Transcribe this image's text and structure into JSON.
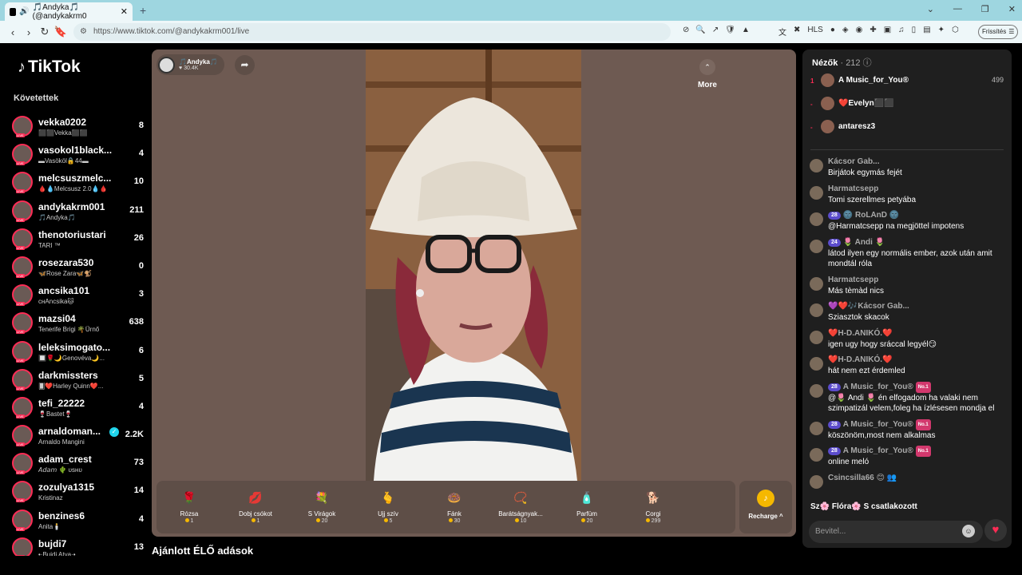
{
  "browser": {
    "tab_title": "🎵Andyka🎵 (@andykakrm0",
    "url": "https://www.tiktok.com/@andykakrm001/live",
    "update_label": "Frissítés"
  },
  "tiktok": {
    "logo": "TikTok",
    "following_title": "Követettek",
    "accounts": [
      {
        "name": "vekka0202",
        "sub": "⬛⬛Vekka⬛⬛",
        "count": "8"
      },
      {
        "name": "vasokol1black...",
        "sub": "▬Vasököl🔒44▬",
        "count": "4"
      },
      {
        "name": "melcsuszmelc...",
        "sub": "🩸💧Melcsusz 2.0💧🩸",
        "count": "10"
      },
      {
        "name": "andykakrm001",
        "sub": "🎵Andyka🎵",
        "count": "211"
      },
      {
        "name": "thenotoriustari",
        "sub": "TARI ™",
        "count": "26"
      },
      {
        "name": "rosezara530",
        "sub": "🦋Rose Zara🦋🐒",
        "count": "0"
      },
      {
        "name": "ancsika101",
        "sub": "ᴄʜAncsika🐱",
        "count": "3"
      },
      {
        "name": "mazsi04",
        "sub": "Tenerife Brigi 🌴Ürnő",
        "count": "638"
      },
      {
        "name": "leleksimogato...",
        "sub": "🔲🌹🌙Genovéva🌙...",
        "count": "6"
      },
      {
        "name": "darkmissters",
        "sub": "🂠❤️Harley Quinn❤️...",
        "count": "5"
      },
      {
        "name": "tefi_22222",
        "sub": "🍷Bastet🍷",
        "count": "4"
      },
      {
        "name": "arnaldoman...",
        "sub": "Arnaldo Mangini",
        "count": "2.2K",
        "verified": "✓"
      },
      {
        "name": "adam_crest",
        "sub": "𝘈𝘥𝘢𝘮 🌵 ᴜsʜᴜ",
        "count": "73"
      },
      {
        "name": "zozulya1315",
        "sub": "Kristinaz",
        "count": "14"
      },
      {
        "name": "benzines6",
        "sub": "Anita🕯️",
        "count": "4"
      },
      {
        "name": "bujdi7",
        "sub": "•·Bujdi Atya·•",
        "count": "13"
      }
    ]
  },
  "stream": {
    "host_name": "🎵Andyka🎵",
    "host_likes": "30.4K",
    "gifts": [
      {
        "name": "Rózsa",
        "coins": "1",
        "icon": "🌹"
      },
      {
        "name": "Dobj csókot",
        "coins": "1",
        "icon": "💋"
      },
      {
        "name": "S Virágok",
        "coins": "20",
        "icon": "💐"
      },
      {
        "name": "Ujj szív",
        "coins": "5",
        "icon": "🫰"
      },
      {
        "name": "Fánk",
        "coins": "30",
        "icon": "🍩"
      },
      {
        "name": "Barátságnyak...",
        "coins": "10",
        "icon": "📿"
      },
      {
        "name": "Parfüm",
        "coins": "20",
        "icon": "🧴"
      },
      {
        "name": "Corgi",
        "coins": "299",
        "icon": "🐕"
      }
    ],
    "more_label": "More",
    "recharge_label": "Recharge ^",
    "recommended_title": "Ajánlott ÉLŐ adások"
  },
  "chat": {
    "viewers_label": "Nézők",
    "viewers_count": "· 212",
    "top_viewers": [
      {
        "rank": "1",
        "name": "A Music_for_You®",
        "score": "499"
      },
      {
        "rank": "-",
        "name": "❤️Evelyn⬛⬛",
        "score": ""
      },
      {
        "rank": "-",
        "name": "antaresz3",
        "score": ""
      }
    ],
    "comments": [
      {
        "user": "Kácsor Gab...",
        "text": "Birjátok egymás fejét",
        "level": ""
      },
      {
        "user": "Harmatcsepp",
        "text": "Tomi szerellmes petyába",
        "level": ""
      },
      {
        "user": "🌚 RoLAnD 🌚",
        "text": "@Harmatcsepp na megjöttel impotens",
        "level": "28"
      },
      {
        "user": "🌷 Andi 🌷",
        "text": "látod ilyen egy normális ember, azok után amit mondtál róla",
        "level": "24"
      },
      {
        "user": "Harmatcsepp",
        "text": "Más tèmàd nics",
        "level": ""
      },
      {
        "user": "💜❤️🎶Kácsor Gab...",
        "text": "Sziasztok skacok",
        "level": ""
      },
      {
        "user": "❤️H-D.ANIKÓ.❤️",
        "text": "igen ugy hogy sráccal legyél😏",
        "level": ""
      },
      {
        "user": "❤️H-D.ANIKÓ.❤️",
        "text": "hát nem ezt érdemled",
        "level": ""
      },
      {
        "user": "A Music_for_You®",
        "text": "@🌷 Andi 🌷 én elfogadom ha valaki nem szimpatizál velem,foleg ha ízlésesen mondja el",
        "level": "28",
        "tag": "No.1"
      },
      {
        "user": "A Music_for_You®",
        "text": "köszönöm,most nem alkalmas",
        "level": "28",
        "tag": "No.1"
      },
      {
        "user": "A Music_for_You®",
        "text": "online meló",
        "level": "28",
        "tag": "No.1"
      },
      {
        "user": "Csincsilla66 😊 👥",
        "text": "",
        "level": ""
      }
    ],
    "joined_text": "Sz🌸 Flóra🌸 S  csatlakozott",
    "input_placeholder": "Bevitel..."
  }
}
